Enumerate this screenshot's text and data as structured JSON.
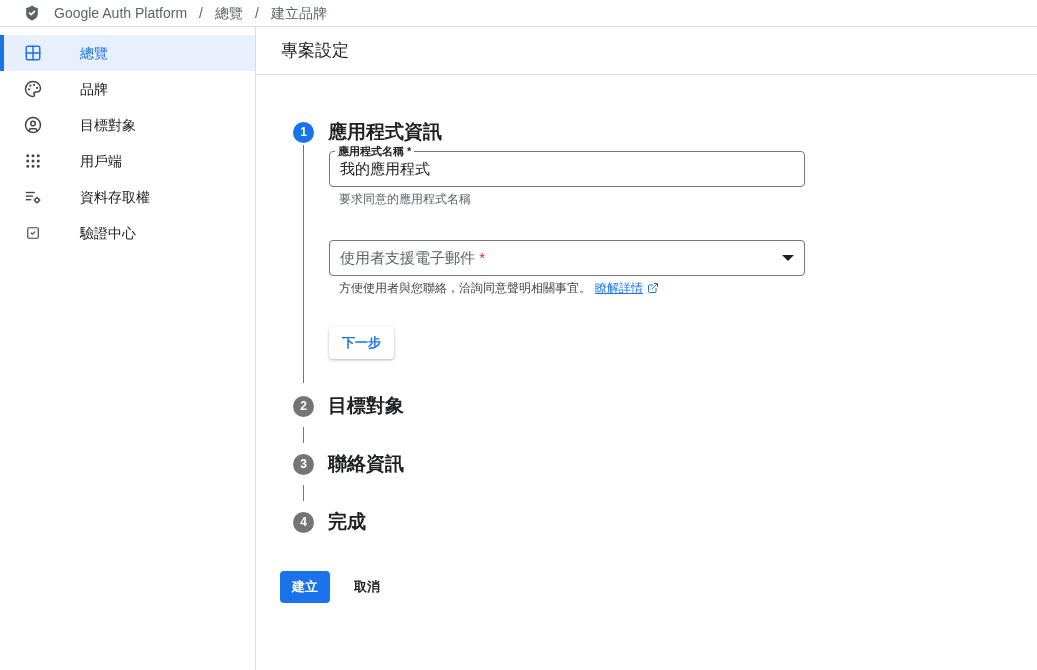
{
  "breadcrumb": {
    "product": "Google Auth Platform",
    "separator": "/",
    "items": [
      "總覽",
      "建立品牌"
    ]
  },
  "sidebar": {
    "items": [
      {
        "label": "總覽",
        "selected": true
      },
      {
        "label": "品牌",
        "selected": false
      },
      {
        "label": "目標對象",
        "selected": false
      },
      {
        "label": "用戶端",
        "selected": false
      },
      {
        "label": "資料存取權",
        "selected": false
      },
      {
        "label": "驗證中心",
        "selected": false
      }
    ]
  },
  "page_title": "專案設定",
  "steps": [
    {
      "number": "1",
      "title": "應用程式資訊",
      "selected": true,
      "fields": [
        {
          "kind": "text",
          "label": "應用程式名稱 *",
          "value": "我的應用程式",
          "hint": "要求同意的應用程式名稱"
        },
        {
          "kind": "select",
          "placeholder": "使用者支援電子郵件",
          "required": "*",
          "hint": "方便使用者與您聯絡，洽詢同意聲明相關事宜。",
          "link": "瞭解詳情"
        }
      ],
      "next_button": "下一步"
    },
    {
      "number": "2",
      "title": "目標對象",
      "selected": false
    },
    {
      "number": "3",
      "title": "聯絡資訊",
      "selected": false
    },
    {
      "number": "4",
      "title": "完成",
      "selected": false
    }
  ],
  "actions": {
    "primary": "建立",
    "secondary": "取消"
  }
}
